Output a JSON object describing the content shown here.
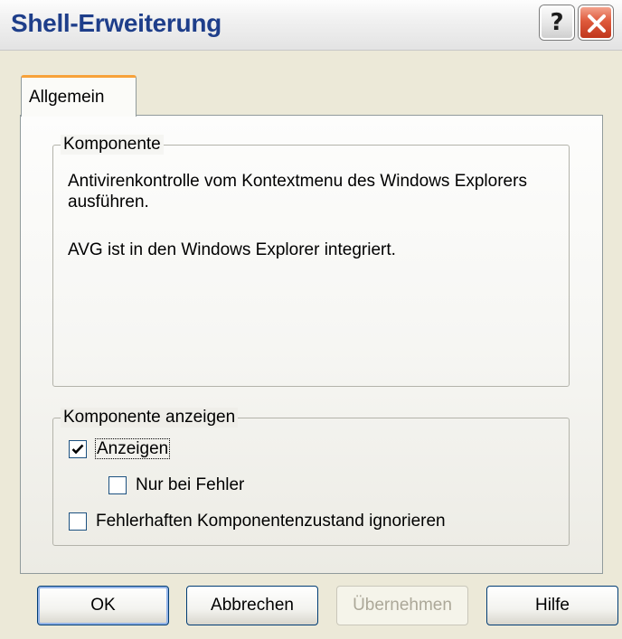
{
  "window": {
    "title": "Shell-Erweiterung",
    "help_button": "?",
    "close_button_icon": "close-x-icon"
  },
  "tabs": [
    {
      "label": "Allgemein",
      "active": true
    }
  ],
  "component_group": {
    "legend": "Komponente",
    "description_1": "Antivirenkontrolle vom Kontextmenu des Windows Explorers ausführen.",
    "description_2": "AVG ist in den Windows Explorer integriert."
  },
  "display_group": {
    "legend": "Komponente anzeigen",
    "options": [
      {
        "label": "Anzeigen",
        "checked": true
      },
      {
        "label": "Nur bei Fehler",
        "checked": false
      },
      {
        "label": "Fehlerhaften Komponentenzustand ignorieren",
        "checked": false
      }
    ]
  },
  "buttons": {
    "ok": "OK",
    "cancel": "Abbrechen",
    "apply": "Übernehmen",
    "apply_enabled": false,
    "help": "Hilfe"
  },
  "colors": {
    "title_text": "#1e3e8a",
    "close_button": "#df5a3c",
    "tab_highlight": "#f7a23a",
    "dialog_background": "#ece9d8"
  }
}
